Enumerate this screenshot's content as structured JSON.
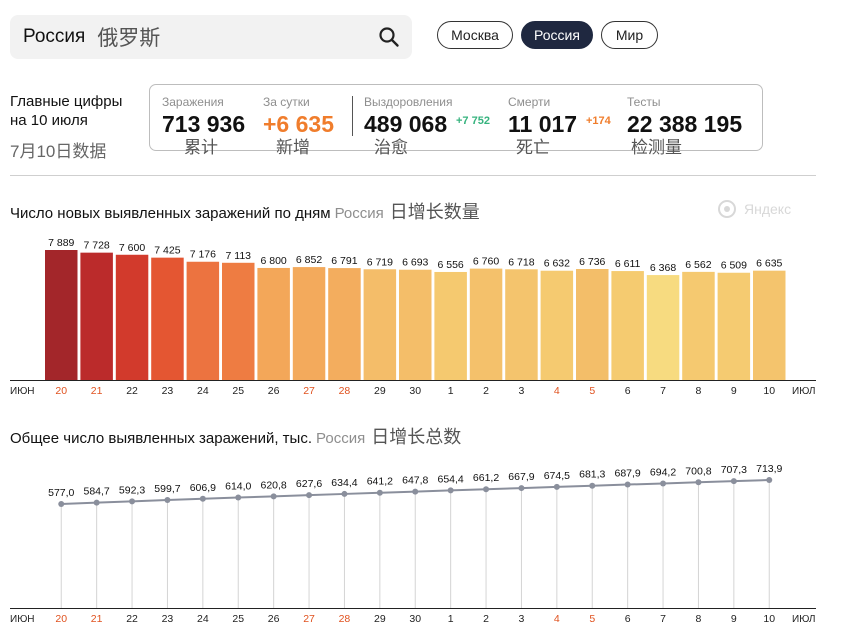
{
  "search": {
    "query": "Россия",
    "query_zh": "俄罗斯"
  },
  "region_pills": [
    {
      "label": "Москва",
      "active": false
    },
    {
      "label": "Россия",
      "active": true
    },
    {
      "label": "Мир",
      "active": false
    }
  ],
  "main_numbers": {
    "title_line1": "Главные цифры",
    "title_line2": "на 10 июля",
    "title_zh": "7月10日数据",
    "stats": [
      {
        "label": "Заражения",
        "value": "713 936",
        "zh": "累计"
      },
      {
        "label": "За сутки",
        "value": "+6 635",
        "zh": "新增"
      },
      {
        "label": "Выздоровления",
        "value": "489 068",
        "delta": "+7 752",
        "zh": "治愈"
      },
      {
        "label": "Смерти",
        "value": "11 017",
        "delta": "+174",
        "zh": "死亡"
      },
      {
        "label": "Тесты",
        "value": "22 388 195",
        "zh": "检测量"
      }
    ]
  },
  "daily_chart_title": {
    "main": "Число новых выявленных заражений по дням",
    "region": "Россия",
    "zh": "日增长数量"
  },
  "total_chart_title": {
    "main": "Общее число выявленных заражений, тыс.",
    "region": "Россия",
    "zh": "日增长总数"
  },
  "watermark": "Яндекс",
  "colors": {
    "accent_orange": "#f07d2c",
    "green": "#36b37e",
    "weekend_red": "#e0521f",
    "pill_active": "#1f2840"
  },
  "chart_data": [
    {
      "type": "bar",
      "title": "Число новых выявленных заражений по дням",
      "x_start_label": "июн",
      "x_end_label": "июл",
      "categories": [
        "20",
        "21",
        "22",
        "23",
        "24",
        "25",
        "26",
        "27",
        "28",
        "29",
        "30",
        "1",
        "2",
        "3",
        "4",
        "5",
        "6",
        "7",
        "8",
        "9",
        "10"
      ],
      "values": [
        7889,
        7728,
        7600,
        7425,
        7176,
        7113,
        6800,
        6852,
        6791,
        6719,
        6693,
        6556,
        6760,
        6718,
        6632,
        6736,
        6611,
        6368,
        6562,
        6509,
        6635
      ],
      "value_labels": [
        "7 889",
        "7 728",
        "7 600",
        "7 425",
        "7 176",
        "7 113",
        "6 800",
        "6 852",
        "6 791",
        "6 719",
        "6 693",
        "6 556",
        "6 760",
        "6 718",
        "6 632",
        "6 736",
        "6 611",
        "6 368",
        "6 562",
        "6 509",
        "6 635"
      ],
      "bar_colors": [
        "#a3262a",
        "#bb2b2b",
        "#d23a2c",
        "#e45632",
        "#ec7340",
        "#ee7c42",
        "#f3a759",
        "#f3aa5c",
        "#f3ad5e",
        "#f4bd69",
        "#f4be69",
        "#f5c96f",
        "#f4c16b",
        "#f4c46d",
        "#f5ca70",
        "#f3be69",
        "#f5cb70",
        "#f7db80",
        "#f5c970",
        "#f5cb71",
        "#f4c46d"
      ],
      "weekend_indices": [
        0,
        1,
        7,
        8,
        14,
        15
      ]
    },
    {
      "type": "line",
      "title": "Общее число выявленных заражений, тыс.",
      "x_start_label": "июн",
      "x_end_label": "июл",
      "categories": [
        "20",
        "21",
        "22",
        "23",
        "24",
        "25",
        "26",
        "27",
        "28",
        "29",
        "30",
        "1",
        "2",
        "3",
        "4",
        "5",
        "6",
        "7",
        "8",
        "9",
        "10"
      ],
      "values": [
        577.0,
        584.7,
        592.3,
        599.7,
        606.9,
        614.0,
        620.8,
        627.6,
        634.4,
        641.2,
        647.8,
        654.4,
        661.2,
        667.9,
        674.5,
        681.3,
        687.9,
        694.2,
        700.8,
        707.3,
        713.9
      ],
      "value_labels": [
        "577,0",
        "584,7",
        "592,3",
        "599,7",
        "606,9",
        "614,0",
        "620,8",
        "627,6",
        "634,4",
        "641,2",
        "647,8",
        "654,4",
        "661,2",
        "667,9",
        "674,5",
        "681,3",
        "687,9",
        "694,2",
        "700,8",
        "707,3",
        "713,9"
      ],
      "weekend_indices": [
        0,
        1,
        7,
        8,
        14,
        15
      ]
    }
  ]
}
